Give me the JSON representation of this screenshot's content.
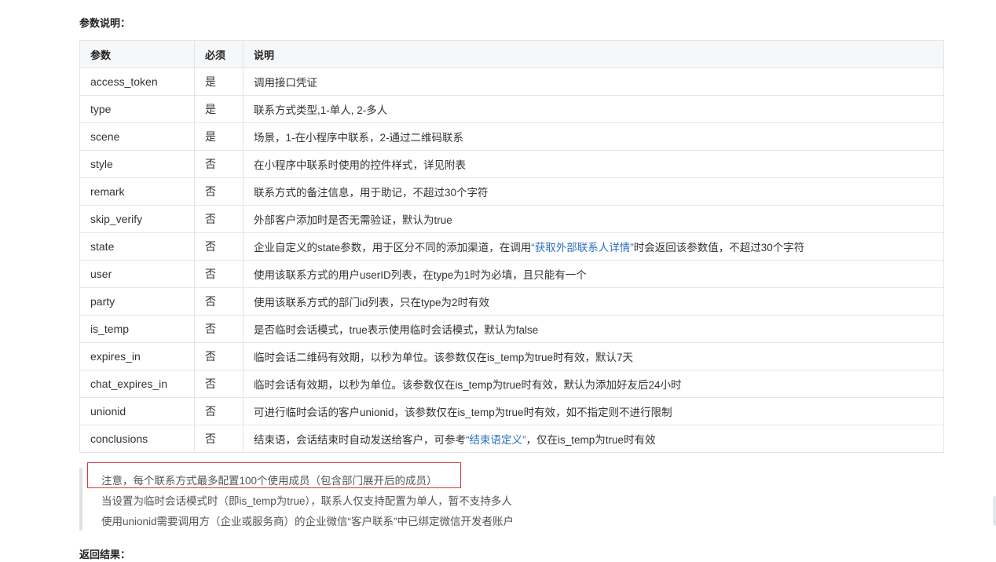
{
  "params_title": "参数说明：",
  "table": {
    "headers": [
      "参数",
      "必须",
      "说明"
    ],
    "rows": [
      {
        "name": "access_token",
        "required": "是",
        "desc": "调用接口凭证"
      },
      {
        "name": "type",
        "required": "是",
        "desc": "联系方式类型,1-单人, 2-多人"
      },
      {
        "name": "scene",
        "required": "是",
        "desc": "场景，1-在小程序中联系，2-通过二维码联系"
      },
      {
        "name": "style",
        "required": "否",
        "desc": "在小程序中联系时使用的控件样式，详见附表"
      },
      {
        "name": "remark",
        "required": "否",
        "desc": "联系方式的备注信息，用于助记，不超过30个字符"
      },
      {
        "name": "skip_verify",
        "required": "否",
        "desc": "外部客户添加时是否无需验证，默认为true"
      },
      {
        "name": "state",
        "required": "否",
        "desc_pre": "企业自定义的state参数，用于区分不同的添加渠道，在调用",
        "desc_link": "“获取外部联系人详情”",
        "desc_post": "时会返回该参数值，不超过30个字符"
      },
      {
        "name": "user",
        "required": "否",
        "desc": "使用该联系方式的用户userID列表，在type为1时为必填，且只能有一个"
      },
      {
        "name": "party",
        "required": "否",
        "desc": "使用该联系方式的部门id列表，只在type为2时有效"
      },
      {
        "name": "is_temp",
        "required": "否",
        "desc": "是否临时会话模式，true表示使用临时会话模式，默认为false"
      },
      {
        "name": "expires_in",
        "required": "否",
        "desc": "临时会话二维码有效期，以秒为单位。该参数仅在is_temp为true时有效，默认7天"
      },
      {
        "name": "chat_expires_in",
        "required": "否",
        "desc": "临时会话有效期，以秒为单位。该参数仅在is_temp为true时有效，默认为添加好友后24小时"
      },
      {
        "name": "unionid",
        "required": "否",
        "desc": "可进行临时会话的客户unionid，该参数仅在is_temp为true时有效，如不指定则不进行限制"
      },
      {
        "name": "conclusions",
        "required": "否",
        "desc_pre": "结束语，会话结束时自动发送给客户，可参考",
        "desc_link": "“结束语定义”",
        "desc_post": "，仅在is_temp为true时有效"
      }
    ]
  },
  "notes": [
    "注意，每个联系方式最多配置100个使用成员（包含部门展开后的成员）",
    "当设置为临时会话模式时（即is_temp为true），联系人仅支持配置为单人，暂不支持多人",
    "使用unionid需要调用方（企业或服务商）的企业微信“客户联系”中已绑定微信开发者账户"
  ],
  "return_title": "返回结果：",
  "colors": {
    "link": "#2d6fc1",
    "highlight_border": "#d9363e",
    "header_bg": "#f6f7f9"
  }
}
